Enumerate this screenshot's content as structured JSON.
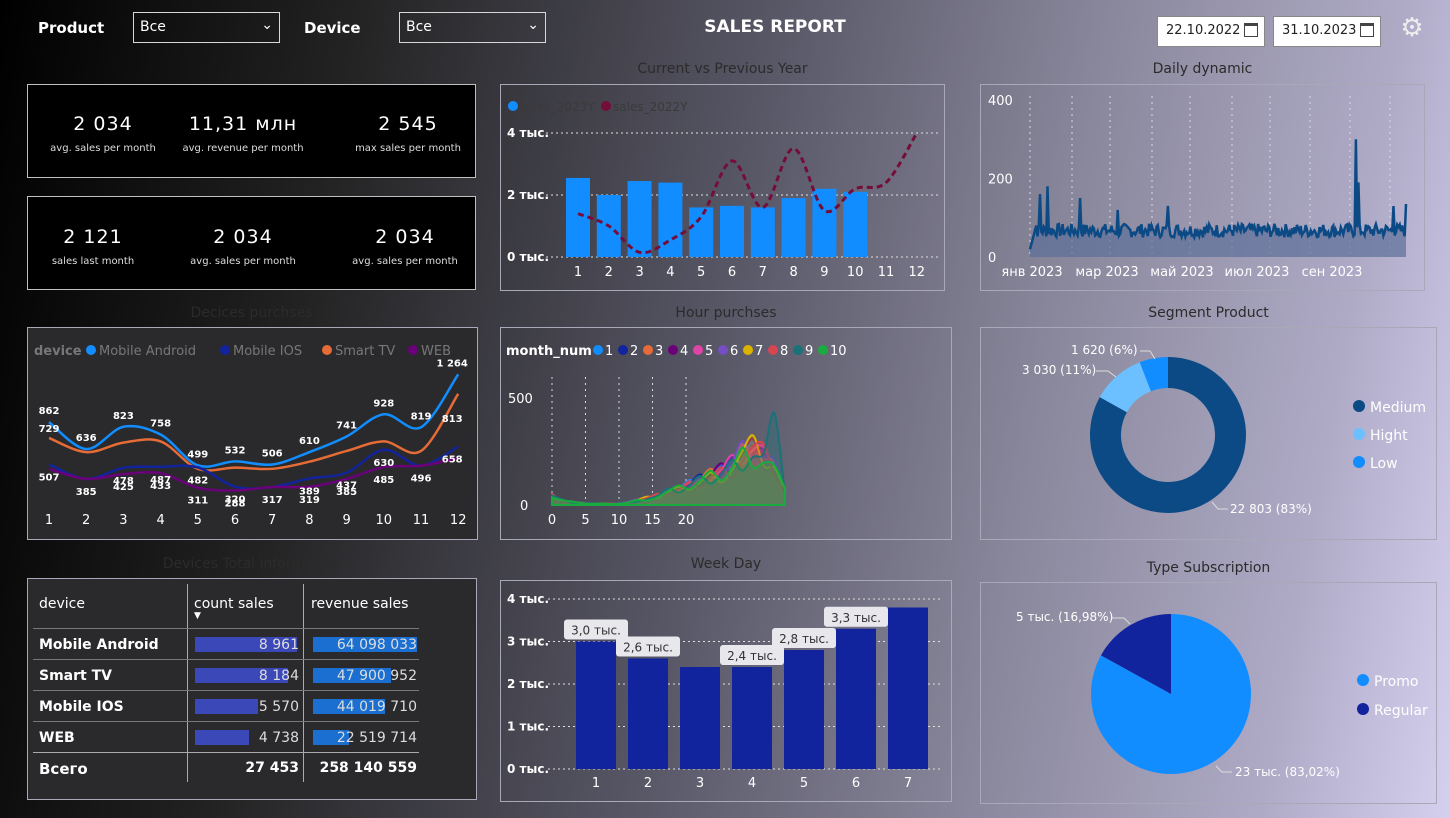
{
  "header": {
    "product_label": "Product",
    "product_value": "Все",
    "device_label": "Device",
    "device_value": "Все",
    "title": "SALES REPORT",
    "date_from": "22.10.2022",
    "date_to": "31.10.2023"
  },
  "kpi_cards": [
    {
      "items": [
        {
          "value": "2 034",
          "label": "avg. sales per month"
        },
        {
          "value": "11,31 млн",
          "label": "avg. revenue per month"
        },
        {
          "value": "2 545",
          "label": "max sales per month"
        }
      ]
    },
    {
      "items": [
        {
          "value": "2 121",
          "label": "sales last month"
        },
        {
          "value": "2 034",
          "label": "avg. sales per month"
        },
        {
          "value": "2 034",
          "label": "avg. sales per month"
        }
      ]
    }
  ],
  "titles": {
    "cvp": "Current vs Previous Year",
    "daily": "Daily dynamic",
    "devices": "Decices purchses",
    "hour": "Hour purchses",
    "segment": "Segment Product",
    "total": "Devices Total information",
    "week": "Week Day",
    "subscription": "Type Subscription"
  },
  "chart_data": [
    {
      "type": "bar",
      "id": "cvp",
      "legend": [
        "sales_2023Y",
        "sales_2022Y"
      ],
      "categories": [
        "1",
        "2",
        "3",
        "4",
        "5",
        "6",
        "7",
        "8",
        "9",
        "10",
        "11",
        "12"
      ],
      "yticks": [
        "4 тыс.",
        "2 тыс.",
        "0 тыс."
      ],
      "series": [
        {
          "name": "sales_2023Y",
          "values": [
            2550,
            2000,
            2450,
            2400,
            1600,
            1650,
            1600,
            1900,
            2200,
            2100,
            null,
            null
          ]
        },
        {
          "name": "sales_2022Y",
          "values": [
            1400,
            1000,
            150,
            550,
            1300,
            3100,
            1600,
            3500,
            1500,
            2200,
            2400,
            4000
          ]
        }
      ]
    },
    {
      "type": "area",
      "id": "daily",
      "yticks": [
        "400",
        "200",
        "0"
      ],
      "xticks": [
        "янв 2023",
        "мар 2023",
        "май 2023",
        "июл 2023",
        "сен 2023"
      ]
    },
    {
      "type": "line",
      "id": "devices",
      "legend_title": "device",
      "legend": [
        "Mobile Android",
        "Mobile IOS",
        "Smart TV",
        "WEB"
      ],
      "categories": [
        "1",
        "2",
        "3",
        "4",
        "5",
        "6",
        "7",
        "8",
        "9",
        "10",
        "11",
        "12"
      ],
      "series": [
        {
          "name": "Mobile Android",
          "values": [
            862,
            636,
            823,
            758,
            499,
            532,
            506,
            610,
            741,
            928,
            819,
            1264
          ]
        },
        {
          "name": "Smart TV",
          "values": [
            729,
            null,
            null,
            null,
            null,
            null,
            null,
            null,
            null,
            null,
            null,
            813
          ]
        },
        {
          "name": "Mobile IOS",
          "values": [
            507,
            385,
            478,
            487,
            482,
            320,
            317,
            389,
            437,
            630,
            496,
            658
          ]
        },
        {
          "name": "WEB",
          "values": [
            null,
            null,
            425,
            433,
            311,
            288,
            null,
            319,
            385,
            485,
            null,
            null
          ]
        }
      ]
    },
    {
      "type": "area",
      "id": "hour",
      "legend_title": "month_num",
      "legend": [
        "1",
        "2",
        "3",
        "4",
        "5",
        "6",
        "7",
        "8",
        "9",
        "10"
      ],
      "yticks": [
        "500",
        "0"
      ],
      "xticks": [
        "0",
        "5",
        "10",
        "15",
        "20"
      ]
    },
    {
      "type": "pie",
      "id": "segment",
      "legend": [
        "Medium",
        "Hight",
        "Low"
      ],
      "labels": [
        "1 620 (6%)",
        "3 030 (11%)",
        "22 803 (83%)"
      ],
      "values": [
        22803,
        3030,
        1620
      ]
    },
    {
      "type": "bar",
      "id": "week",
      "categories": [
        "1",
        "2",
        "3",
        "4",
        "5",
        "6",
        "7"
      ],
      "yticks": [
        "4 тыс.",
        "3 тыс.",
        "2 тыс.",
        "1 тыс.",
        "0 тыс."
      ],
      "values": [
        3000,
        2600,
        2400,
        2400,
        2800,
        3300,
        3800
      ],
      "labels": [
        "3,0 тыс.",
        "2,6 тыс.",
        "",
        "2,4 тыс.",
        "2,8 тыс.",
        "3,3 тыс.",
        ""
      ]
    },
    {
      "type": "pie",
      "id": "subscription",
      "legend": [
        "Promo",
        "Regular"
      ],
      "labels": [
        "5 тыс. (16,98%)",
        "23 тыс. (83,02%)"
      ],
      "values": [
        83.02,
        16.98
      ]
    }
  ],
  "table": {
    "headers": [
      "device",
      "count sales",
      "revenue sales"
    ],
    "rows": [
      {
        "device": "Mobile Android",
        "count": "8 961",
        "revenue": "64 098 033",
        "cf": 1.0,
        "rf": 1.0
      },
      {
        "device": "Smart TV",
        "count": "8 184",
        "revenue": "47 900 952",
        "cf": 0.91,
        "rf": 0.75
      },
      {
        "device": "Mobile IOS",
        "count": "5 570",
        "revenue": "44 019 710",
        "cf": 0.62,
        "rf": 0.69
      },
      {
        "device": "WEB",
        "count": "4 738",
        "revenue": "22 519 714",
        "cf": 0.53,
        "rf": 0.35
      }
    ],
    "total": {
      "label": "Всего",
      "count": "27 453",
      "revenue": "258 140 559"
    }
  },
  "colors": {
    "blue": "#118dff",
    "dark_blue": "#12239e",
    "orange": "#e66c37",
    "purple": "#6b007b",
    "maroon": "#750d3a",
    "navy": "#0c4a86",
    "light_blue": "#6cc0ff"
  }
}
